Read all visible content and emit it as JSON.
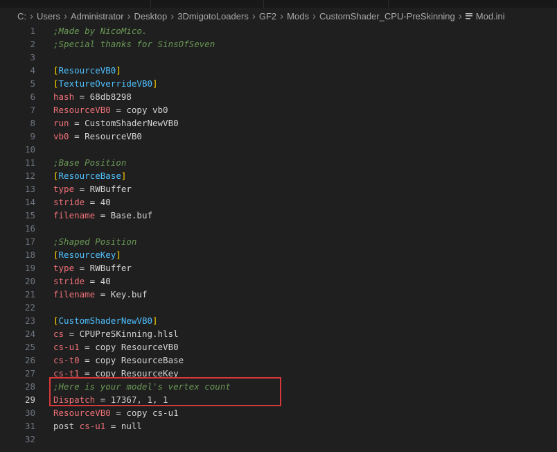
{
  "breadcrumb": {
    "segments": [
      "C:",
      "Users",
      "Administrator",
      "Desktop",
      "3DmigotoLoaders",
      "GF2",
      "Mods",
      "CustomShader_CPU-PreSkinning"
    ],
    "file": "Mod.ini",
    "file_icon": "lines-icon"
  },
  "editor": {
    "active_line": 29,
    "colors": {
      "comment": "#6a9955",
      "key": "#f07178",
      "bracket": "#ffd700",
      "section": "#4fc1ff",
      "text": "#d4d4d4",
      "highlight_border": "#d9383a"
    },
    "lines": [
      {
        "n": "1",
        "tokens": [
          {
            "t": ";Made by NicoMico.",
            "c": "comment"
          }
        ]
      },
      {
        "n": "2",
        "tokens": [
          {
            "t": ";Special thanks for SinsOfSeven",
            "c": "comment"
          }
        ]
      },
      {
        "n": "3",
        "tokens": []
      },
      {
        "n": "4",
        "tokens": [
          {
            "t": "[",
            "c": "br"
          },
          {
            "t": "ResourceVB0",
            "c": "sec"
          },
          {
            "t": "]",
            "c": "br"
          }
        ]
      },
      {
        "n": "5",
        "tokens": [
          {
            "t": "[",
            "c": "br"
          },
          {
            "t": "TextureOverrideVB0",
            "c": "sec"
          },
          {
            "t": "]",
            "c": "br"
          }
        ]
      },
      {
        "n": "6",
        "tokens": [
          {
            "t": "hash",
            "c": "key"
          },
          {
            "t": " = 68db8298",
            "c": "text"
          }
        ]
      },
      {
        "n": "7",
        "tokens": [
          {
            "t": "ResourceVB0",
            "c": "key"
          },
          {
            "t": " = copy vb0",
            "c": "text"
          }
        ]
      },
      {
        "n": "8",
        "tokens": [
          {
            "t": "run",
            "c": "key"
          },
          {
            "t": " = CustomShaderNewVB0",
            "c": "text"
          }
        ]
      },
      {
        "n": "9",
        "tokens": [
          {
            "t": "vb0",
            "c": "key"
          },
          {
            "t": " = ResourceVB0",
            "c": "text"
          }
        ]
      },
      {
        "n": "10",
        "tokens": []
      },
      {
        "n": "11",
        "tokens": [
          {
            "t": ";Base Position",
            "c": "comment"
          }
        ]
      },
      {
        "n": "12",
        "tokens": [
          {
            "t": "[",
            "c": "br"
          },
          {
            "t": "ResourceBase",
            "c": "sec"
          },
          {
            "t": "]",
            "c": "br"
          }
        ]
      },
      {
        "n": "13",
        "tokens": [
          {
            "t": "type",
            "c": "key"
          },
          {
            "t": " = RWBuffer",
            "c": "text"
          }
        ]
      },
      {
        "n": "14",
        "tokens": [
          {
            "t": "stride",
            "c": "key"
          },
          {
            "t": " = 40",
            "c": "text"
          }
        ]
      },
      {
        "n": "15",
        "tokens": [
          {
            "t": "filename",
            "c": "key"
          },
          {
            "t": " = Base.buf",
            "c": "text"
          }
        ]
      },
      {
        "n": "16",
        "tokens": []
      },
      {
        "n": "17",
        "tokens": [
          {
            "t": ";Shaped Position",
            "c": "comment"
          }
        ]
      },
      {
        "n": "18",
        "tokens": [
          {
            "t": "[",
            "c": "br"
          },
          {
            "t": "ResourceKey",
            "c": "sec"
          },
          {
            "t": "]",
            "c": "br"
          }
        ]
      },
      {
        "n": "19",
        "tokens": [
          {
            "t": "type",
            "c": "key"
          },
          {
            "t": " = RWBuffer",
            "c": "text"
          }
        ]
      },
      {
        "n": "20",
        "tokens": [
          {
            "t": "stride",
            "c": "key"
          },
          {
            "t": " = 40",
            "c": "text"
          }
        ]
      },
      {
        "n": "21",
        "tokens": [
          {
            "t": "filename",
            "c": "key"
          },
          {
            "t": " = Key.buf",
            "c": "text"
          }
        ]
      },
      {
        "n": "22",
        "tokens": []
      },
      {
        "n": "23",
        "tokens": [
          {
            "t": "[",
            "c": "br"
          },
          {
            "t": "CustomShaderNewVB0",
            "c": "sec"
          },
          {
            "t": "]",
            "c": "br"
          }
        ]
      },
      {
        "n": "24",
        "tokens": [
          {
            "t": "cs",
            "c": "key"
          },
          {
            "t": " = CPUPreSKinning.hlsl",
            "c": "text"
          }
        ]
      },
      {
        "n": "25",
        "tokens": [
          {
            "t": "cs-u1",
            "c": "key"
          },
          {
            "t": " = copy ResourceVB0",
            "c": "text"
          }
        ]
      },
      {
        "n": "26",
        "tokens": [
          {
            "t": "cs-t0",
            "c": "key"
          },
          {
            "t": " = copy ResourceBase",
            "c": "text"
          }
        ]
      },
      {
        "n": "27",
        "tokens": [
          {
            "t": "cs-t1",
            "c": "key"
          },
          {
            "t": " = copy ResourceKey",
            "c": "text"
          }
        ]
      },
      {
        "n": "28",
        "tokens": [
          {
            "t": ";Here is your model's vertex count",
            "c": "comment dim"
          }
        ]
      },
      {
        "n": "29",
        "tokens": [
          {
            "t": "Dispatch",
            "c": "key"
          },
          {
            "t": " = 17367, 1, 1",
            "c": "text"
          }
        ]
      },
      {
        "n": "30",
        "tokens": [
          {
            "t": "ResourceVB0",
            "c": "key"
          },
          {
            "t": " = copy cs-u1",
            "c": "text"
          }
        ]
      },
      {
        "n": "31",
        "tokens": [
          {
            "t": "post ",
            "c": "text"
          },
          {
            "t": "cs-u1",
            "c": "key"
          },
          {
            "t": " = null",
            "c": "text"
          }
        ]
      },
      {
        "n": "32",
        "tokens": []
      }
    ]
  }
}
